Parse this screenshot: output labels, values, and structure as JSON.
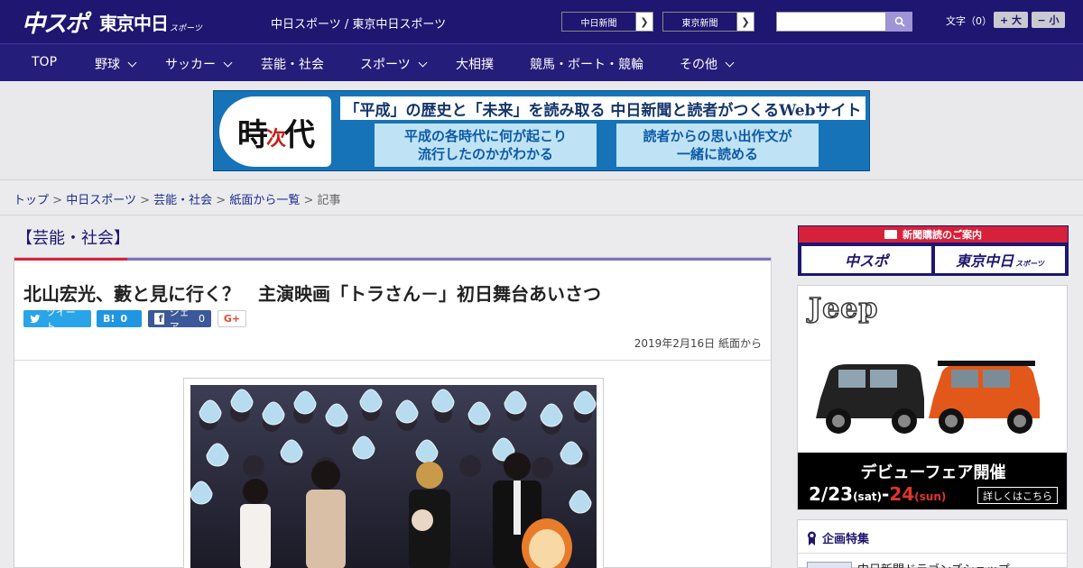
{
  "header": {
    "logo_main": "中スポ",
    "logo_tokyo": "東京中日",
    "logo_sports": "スポーツ",
    "site_names": "中日スポーツ / 東京中日スポーツ",
    "papers": [
      "中日新聞",
      "東京新聞"
    ],
    "search_placeholder": "",
    "font_size_label": "文字（0）",
    "font_plus": "+ 大",
    "font_minus": "− 小"
  },
  "nav": {
    "items": [
      {
        "label": "TOP",
        "has_menu": false
      },
      {
        "label": "野球",
        "has_menu": true
      },
      {
        "label": "サッカー",
        "has_menu": true
      },
      {
        "label": "芸能・社会",
        "has_menu": false
      },
      {
        "label": "スポーツ",
        "has_menu": true
      },
      {
        "label": "大相撲",
        "has_menu": false
      },
      {
        "label": "競馬・ボート・競輪",
        "has_menu": false
      },
      {
        "label": "その他",
        "has_menu": true
      }
    ]
  },
  "banner": {
    "kanji": "時",
    "kanji_small": "次",
    "kanji_end": "代",
    "title": "「平成」の歴史と「未来」を読み取る 中日新聞と読者がつくるWebサイト",
    "box1_line1": "平成の各時代に何が起こり",
    "box1_line2": "流行したのかがわかる",
    "box2_line1": "読者からの思い出作文が",
    "box2_line2": "一緒に読める"
  },
  "breadcrumb": {
    "items": [
      "トップ",
      "中日スポーツ",
      "芸能・社会",
      "紙面から一覧"
    ],
    "separator": ">",
    "current": "記事"
  },
  "section": {
    "label": "【芸能・社会】"
  },
  "article": {
    "headline": "北山宏光、藪と見に行く？　主演映画「トラさん－」初日舞台あいさつ",
    "share": {
      "tweet": "ツイート",
      "hatena_label": "B!",
      "hatena_count": "0",
      "facebook_label": "シェア",
      "facebook_count": "0",
      "gplus": "G+"
    },
    "dateline": "2019年2月16日 紙面から"
  },
  "sidebar": {
    "subscribe_head": "新聞購読のご案内",
    "subscribe_btn1": "中スポ",
    "subscribe_btn2": "東京中日",
    "subscribe_btn2_small": "スポーツ",
    "ad_brand": "Jeep",
    "ad_fair": "デビューフェア開催",
    "ad_date1": "2/23",
    "ad_date1_day": "(sat)",
    "ad_dash": "-",
    "ad_date2": "24",
    "ad_date2_day": "(sun)",
    "ad_more": "詳しくはこちら",
    "feature_head": "企画特集",
    "feature_item": "中日新聞ドラゴンズショップ"
  },
  "colors": {
    "header_bg": "#1e1670",
    "nav_bg": "#251d7a",
    "accent_red": "#d6233a",
    "accent_purple": "#7d70bf",
    "link": "#1a2b8c"
  }
}
